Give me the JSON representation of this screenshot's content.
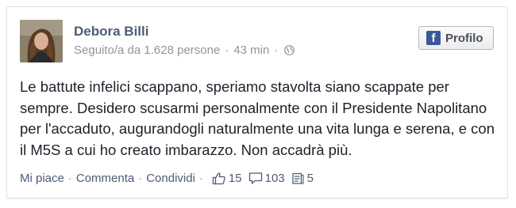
{
  "post": {
    "author": "Debora Billi",
    "followers_text": "Seguito/a da 1.628 persone",
    "time": "43 min",
    "meta_separator": "·",
    "audience_icon": "globe-icon",
    "profile_button_label": "Profilo",
    "text": "Le battute infelici scappano, speriamo stavolta siano scappate per sempre. Desidero scusarmi personalmente con il Presidente Napolitano per l'accaduto, augurandogli naturalmente una vita lunga e serena, e con il M5S a cui ho creato imbarazzo. Non accadrà più.",
    "actions": {
      "like": "Mi piace",
      "comment": "Commenta",
      "share": "Condividi",
      "separator": "·"
    },
    "stats": {
      "likes": "15",
      "comments": "103",
      "shares": "5"
    }
  },
  "colors": {
    "facebook_blue": "#3b5998",
    "link": "#4e5a78",
    "meta": "#90949c",
    "text": "#1d2129"
  }
}
